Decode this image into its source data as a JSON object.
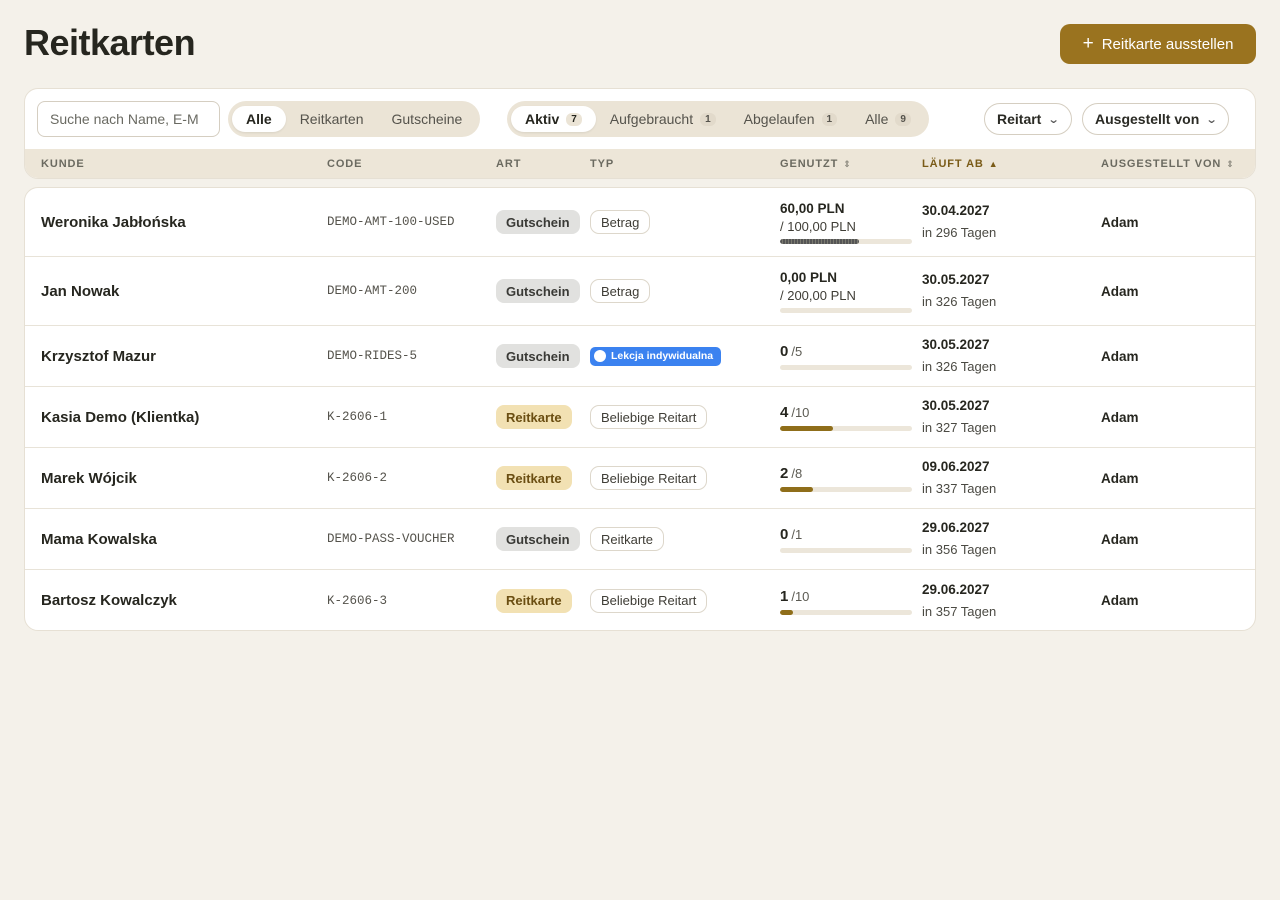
{
  "page": {
    "title": "Reitkarten"
  },
  "actions": {
    "issue_label": "Reitkarte ausstellen",
    "issue_icon": "plus-icon"
  },
  "filters": {
    "search_placeholder": "Suche nach Name, E-M",
    "kind": {
      "items": [
        {
          "label": "Alle",
          "active": true
        },
        {
          "label": "Reitkarten",
          "active": false
        },
        {
          "label": "Gutscheine",
          "active": false
        }
      ]
    },
    "status": {
      "items": [
        {
          "label": "Aktiv",
          "count": "7",
          "active": true
        },
        {
          "label": "Aufgebraucht",
          "count": "1",
          "active": false
        },
        {
          "label": "Abgelaufen",
          "count": "1",
          "active": false
        },
        {
          "label": "Alle",
          "count": "9",
          "active": false
        }
      ]
    },
    "ride_type_label": "Reitart",
    "issued_by_label": "Ausgestellt von"
  },
  "table": {
    "columns": [
      "Kunde",
      "Code",
      "Art",
      "Typ",
      "Genutzt",
      "Läuft ab",
      "Ausgestellt von"
    ],
    "sorted_column": "Läuft ab",
    "rows": [
      {
        "customer": "Weronika Jabłońska",
        "code": "DEMO-AMT-100-USED",
        "art": "Gutschein",
        "typ": "Betrag",
        "used": "60,00 PLN",
        "total": "/ 100,00 PLN",
        "progress": 0.6,
        "expires": "30.04.2027",
        "expires_rel": "in 296 Tagen",
        "issued_by": "Adam"
      },
      {
        "customer": "Jan Nowak",
        "code": "DEMO-AMT-200",
        "art": "Gutschein",
        "typ": "Betrag",
        "used": "0,00 PLN",
        "total": "/ 200,00 PLN",
        "progress": 0,
        "expires": "30.05.2027",
        "expires_rel": "in 326 Tagen",
        "issued_by": "Adam"
      },
      {
        "customer": "Krzysztof Mazur",
        "code": "DEMO-RIDES-5",
        "art": "Gutschein",
        "typ": "Lekcja indywidualna",
        "used": "0",
        "total": "/5",
        "progress": 0,
        "expires": "30.05.2027",
        "expires_rel": "in 326 Tagen",
        "issued_by": "Adam"
      },
      {
        "customer": "Kasia Demo (Klientka)",
        "code": "K-2606-1",
        "art": "Reitkarte",
        "typ": "Beliebige Reitart",
        "used": "4",
        "total": "/10",
        "progress": 0.4,
        "expires": "30.05.2027",
        "expires_rel": "in 327 Tagen",
        "issued_by": "Adam"
      },
      {
        "customer": "Marek Wójcik",
        "code": "K-2606-2",
        "art": "Reitkarte",
        "typ": "Beliebige Reitart",
        "used": "2",
        "total": "/8",
        "progress": 0.25,
        "expires": "09.06.2027",
        "expires_rel": "in 337 Tagen",
        "issued_by": "Adam"
      },
      {
        "customer": "Mama Kowalska",
        "code": "DEMO-PASS-VOUCHER",
        "art": "Gutschein",
        "typ": "Reitkarte",
        "used": "0",
        "total": "/1",
        "progress": 0,
        "expires": "29.06.2027",
        "expires_rel": "in 356 Tagen",
        "issued_by": "Adam"
      },
      {
        "customer": "Bartosz Kowalczyk",
        "code": "K-2606-3",
        "art": "Reitkarte",
        "typ": "Beliebige Reitart",
        "used": "1",
        "total": "/10",
        "progress": 0.1,
        "expires": "29.06.2027",
        "expires_rel": "in 357 Tagen",
        "issued_by": "Adam"
      }
    ]
  },
  "colors": {
    "accent": "#9a731f",
    "background": "#f4f1ea",
    "badge_blue": "#3b82f0",
    "reitkarte_badge": "#f2e1b3",
    "gutschein_badge": "#e1e1df"
  }
}
